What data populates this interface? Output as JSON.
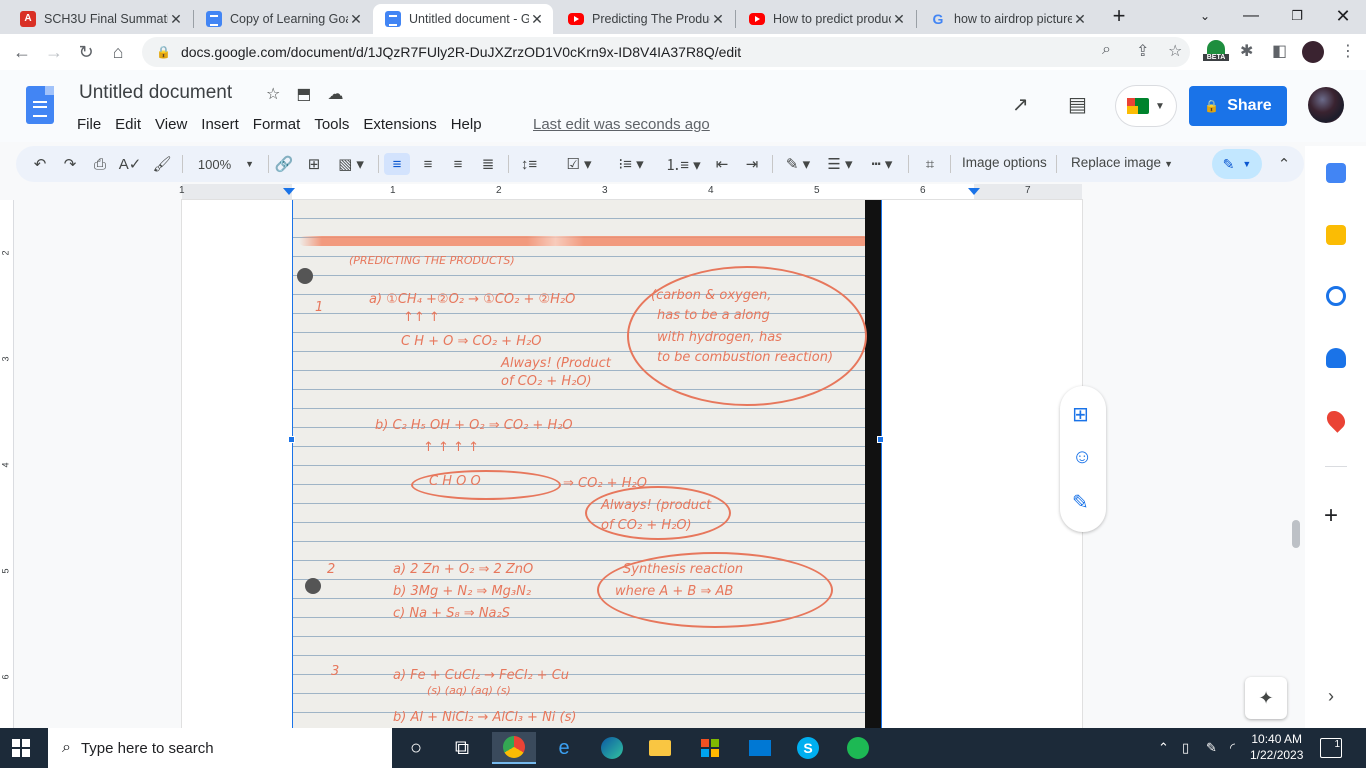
{
  "tabs": [
    {
      "title": "SCH3U Final Summati",
      "icon": "red-app"
    },
    {
      "title": "Copy of Learning Goal",
      "icon": "docs"
    },
    {
      "title": "Untitled document - G",
      "icon": "docs",
      "active": true
    },
    {
      "title": "Predicting The Produc",
      "icon": "youtube"
    },
    {
      "title": "How to predict produc",
      "icon": "youtube"
    },
    {
      "title": "how to airdrop picture",
      "icon": "google"
    }
  ],
  "tab_red_icon_text": "A",
  "tab_google_icon_text": "G",
  "address": {
    "url": "docs.google.com/document/d/1JQzR7FUly2R-DuJXZrzOD1V0cKrn9x-ID8V4IA37R8Q/edit",
    "beta_label": "BETA"
  },
  "doc": {
    "title": "Untitled document",
    "menus": [
      "File",
      "Edit",
      "View",
      "Insert",
      "Format",
      "Tools",
      "Extensions",
      "Help"
    ],
    "last_edit": "Last edit was seconds ago",
    "share_label": "Share"
  },
  "toolbar": {
    "zoom": "100%",
    "image_options": "Image options",
    "replace_image": "Replace image"
  },
  "ruler": {
    "numbers": [
      "1",
      "1",
      "2",
      "3",
      "4",
      "5",
      "6",
      "7"
    ]
  },
  "vruler": {
    "numbers": [
      "2",
      "3",
      "4",
      "5",
      "6"
    ]
  },
  "handwriting": {
    "heading": "(PREDICTING THE PRODUCTS)",
    "q1_num": "1",
    "q1a": "a)  ①CH₄ +②O₂ → ①CO₂ + ②H₂O",
    "q1a_arrows": "↑↑          ↑",
    "q1a_ch": "C H  +  O   ⇒ CO₂ + H₂O",
    "q1a_always": "Always! (Product",
    "q1a_of": "of  CO₂ + H₂O)",
    "note_1": "(carbon & oxygen,",
    "note_2": "has to be a along",
    "note_3": "with hydrogen, has",
    "note_4": "to be combustion reaction)",
    "q1b": "b)  C₂ H₅ OH  +  O₂  ⇒  CO₂  +  H₂O",
    "q1b_arrows": "↑    ↑     ↑           ↑",
    "q1b_chos": "C   H    O       O",
    "q1b_result": "⇒ CO₂ + H₂O",
    "q1b_always": "Always! (product",
    "q1b_of": "of  CO₂ + H₂O)",
    "q2_num": "2",
    "q2a": "a)  2 Zn + O₂      ⇒ 2 ZnO",
    "q2b": "b) 3Mg +  N₂     ⇒ Mg₃N₂",
    "q2c": "c)  Na  +  S₈      ⇒ Na₂S",
    "synth_1": "Synthesis reaction",
    "synth_2": "where   A + B ⇒ AB",
    "q3_num": "3",
    "q3a": "a)   Fe  +  CuCl₂   →  FeCl₂  +  Cu",
    "q3a_states": "(s)          (aq)              (aq)        (s)",
    "q3b": "b)   Al  +  NiCl₂   →  AlCl₃  +  Ni (s)"
  },
  "taskbar": {
    "search_placeholder": "Type here to search",
    "time": "10:40 AM",
    "date": "1/22/2023",
    "notif_count": "1",
    "skype_letter": "S"
  },
  "colors": {
    "accent": "#1a73e8",
    "ink": "#e7775c",
    "taskbar": "#1c2a39"
  }
}
